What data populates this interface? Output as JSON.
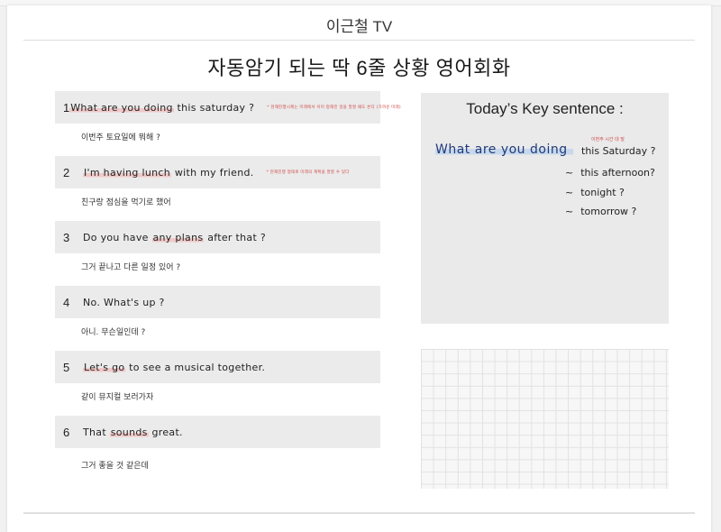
{
  "site": {
    "title": "이근철 TV"
  },
  "document": {
    "title": "자동암기 되는 딱 6줄 상황 영어회화"
  },
  "sentences": [
    {
      "number": "1",
      "highlight": "What are you doing",
      "rest": " this saturday ?",
      "note": "* 현재진행시제는 미래에서 이미 정해진 일을 말할 때도 쓴다 (가까운 미래)",
      "korean": "이번주 토요일에 뭐해 ?"
    },
    {
      "number": "2",
      "highlight": "I'm having lunch",
      "rest": " with my friend.",
      "note": "* 현재진행 형태로 미래의 계획을 말할 수 있다",
      "korean": "친구랑 점심을 먹기로 했어"
    },
    {
      "number": "3",
      "before": "Do you have ",
      "highlight": "any plans",
      "rest": " after that ?",
      "note": "",
      "korean": "그거 끝나고 다른 일정 있어 ?"
    },
    {
      "number": "4",
      "before": "No. What's up ?",
      "highlight": "",
      "rest": "",
      "note": "",
      "korean": "아니. 무슨일인데 ?"
    },
    {
      "number": "5",
      "highlight": "Let's go",
      "rest": " to see a musical together.",
      "note": "",
      "korean": "같이 뮤지컬 보러가자"
    },
    {
      "number": "6",
      "before": "That ",
      "highlight": "sounds",
      "rest": " great.",
      "note": "",
      "korean": "그거 좋을 것 같은데"
    }
  ],
  "key_sentence": {
    "title": "Today’s Key sentence :",
    "main": "What are you doing",
    "note": "이번주 시간 대 말",
    "ending": "this Saturday ?",
    "alternatives": [
      "this afternoon?",
      "tonight ?",
      "tomorrow ?"
    ],
    "tilde": "~"
  },
  "colors": {
    "highlight_pink": "#f0c8c8",
    "highlight_blue": "#c8d8ec",
    "note_red": "#d24a4a",
    "key_blue": "#1f3a7a"
  }
}
